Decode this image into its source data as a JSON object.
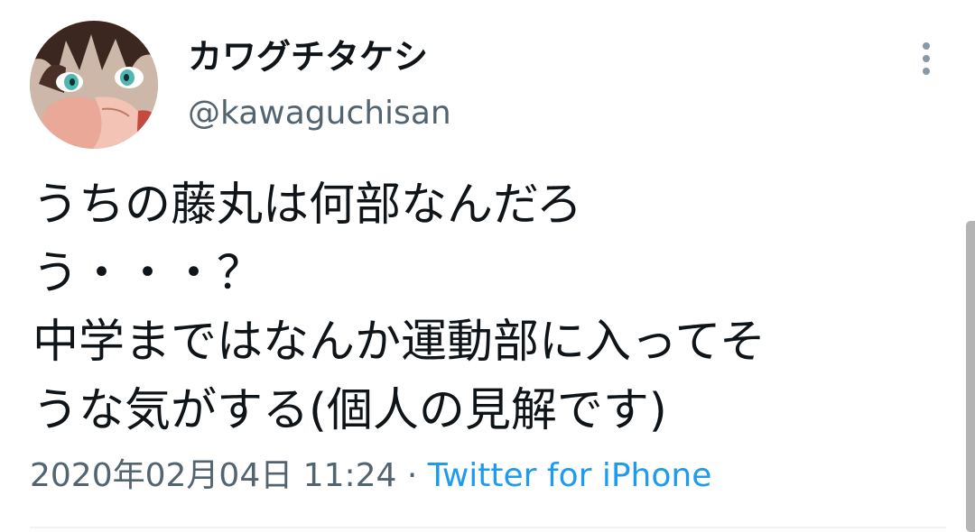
{
  "tweet": {
    "author": {
      "display_name": "カワグチタケシ",
      "handle": "@kawaguchisan"
    },
    "text_lines": [
      "うちの藤丸は何部なんだろ",
      "う・・・？",
      "中学まではなんか運動部に入ってそ",
      "うな気がする(個人の見解です)"
    ],
    "timestamp": "2020年02月04日 11:24",
    "separator": "·",
    "source": "Twitter for iPhone"
  },
  "icons": {
    "more": "more-vertical-icon",
    "avatar": "anime-character-avatar"
  },
  "colors": {
    "text_primary": "#0f1419",
    "text_secondary": "#536471",
    "link": "#1d9bf0",
    "divider": "#eff3f4"
  }
}
